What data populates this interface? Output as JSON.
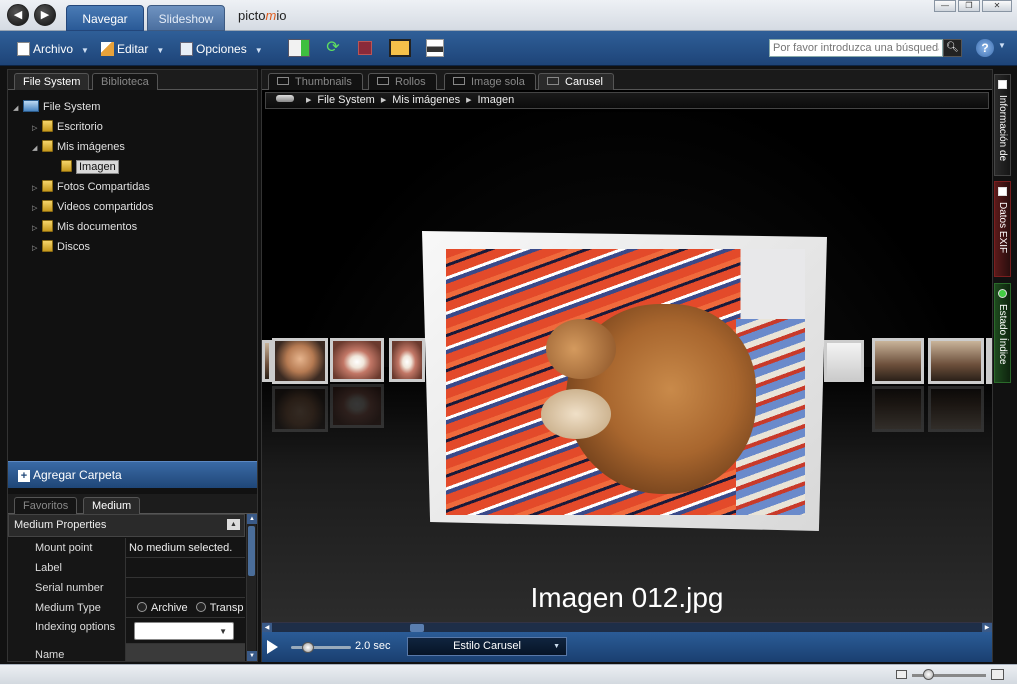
{
  "nav": {
    "back": "◀",
    "forward": "▶"
  },
  "top_tabs": {
    "navegar": "Navegar",
    "slideshow": "Slideshow"
  },
  "brand": {
    "part1": "picto",
    "part2": "m",
    "part3": "io"
  },
  "window": {
    "min": "—",
    "max": "❐",
    "close": "✕"
  },
  "toolbar": {
    "archivo": "Archivo",
    "editar": "Editar",
    "opciones": "Opciones",
    "search_placeholder": "Por favor introduzca una búsqueda",
    "help": "?"
  },
  "left": {
    "tabs": [
      "File System",
      "Biblioteca"
    ],
    "tree": [
      {
        "label": "File System",
        "twisty": "◢"
      },
      {
        "label": "Escritorio",
        "twisty": "▷"
      },
      {
        "label": "Mis imágenes",
        "twisty": "◢"
      },
      {
        "label": "Imagen",
        "twisty": ""
      },
      {
        "label": "Fotos Compartidas",
        "twisty": "▷"
      },
      {
        "label": "Videos compartidos",
        "twisty": "▷"
      },
      {
        "label": "Mis documentos",
        "twisty": "▷"
      },
      {
        "label": "Discos",
        "twisty": "▷"
      }
    ],
    "add_folder": "Agregar Carpeta",
    "bottom_tabs": [
      "Favoritos",
      "Medium"
    ],
    "props_title": "Medium Properties",
    "props": [
      {
        "label": "Mount point",
        "value": "No medium selected."
      },
      {
        "label": "Label",
        "value": ""
      },
      {
        "label": "Serial number",
        "value": ""
      },
      {
        "label": "Medium Type",
        "opt1": "Archive",
        "opt2": "Transp"
      },
      {
        "label": "Indexing options",
        "value": ""
      },
      {
        "label": "Name",
        "value": ""
      }
    ]
  },
  "center": {
    "view_tabs": [
      "Thumbnails",
      "Rollos",
      "Image sola",
      "Carusel"
    ],
    "breadcrumb": [
      "File System",
      "Mis imágenes",
      "Imagen"
    ],
    "caption": "Imagen 012.jpg",
    "dots": "• • • • •",
    "speed": "2.0 sec",
    "style": "Estilo Carusel"
  },
  "side": {
    "info": "Información de",
    "exif": "Datos EXIF",
    "estado": "Estado Índice"
  }
}
